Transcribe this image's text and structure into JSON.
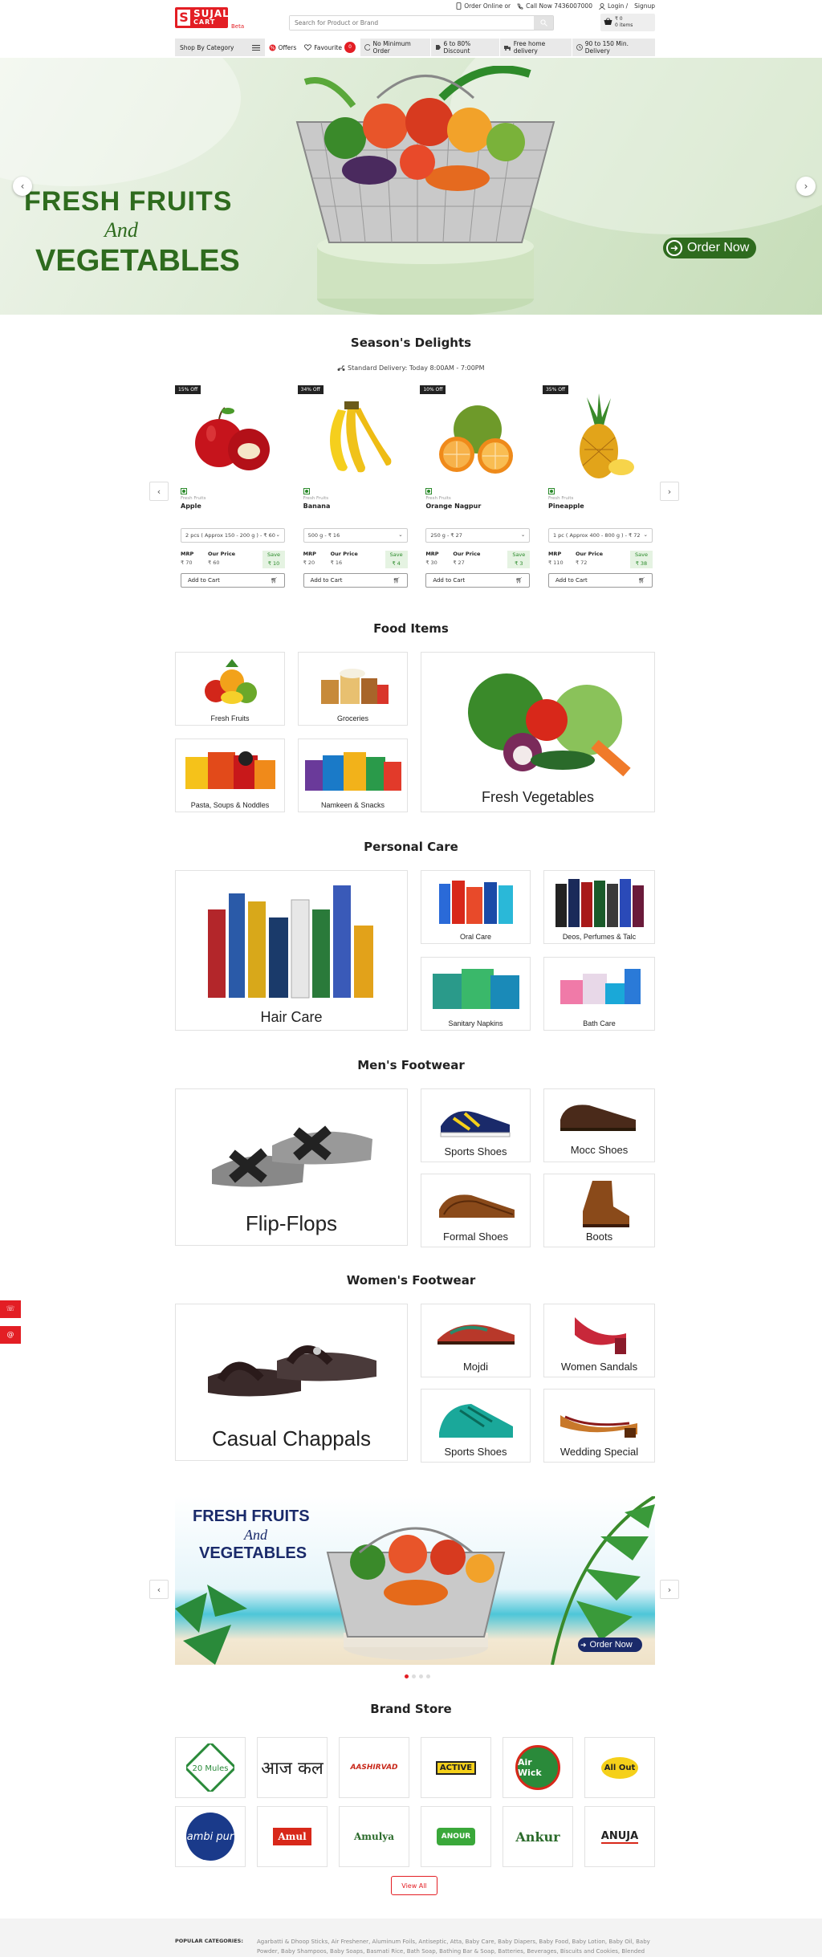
{
  "header": {
    "logo_main": "SUJAL",
    "logo_sub": "CART",
    "logo_letter": "S",
    "beta": "Beta",
    "order_online": "Order Online or",
    "call_now": "Call Now 7436007000",
    "login": "Login /",
    "signup": "Signup",
    "search_placeholder": "Search for Product or Brand",
    "cart_amount": "₹ 0",
    "cart_items": "0 items"
  },
  "nav": {
    "category": "Shop By Category",
    "offers": "Offers",
    "favourite": "Favourite",
    "favourite_count": "0",
    "features": [
      "No Minimum Order",
      "6 to 80% Discount",
      "Free home delivery",
      "90 to 150 Min. Delivery"
    ]
  },
  "hero": {
    "line1": "FRESH FRUITS",
    "and": "And",
    "line2": "VEGETABLES",
    "cta": "Order Now"
  },
  "season": {
    "title": "Season's Delights",
    "delivery": "Standard Delivery: Today 8:00AM - 7:00PM",
    "products": [
      {
        "off": "15% Off",
        "cat": "Fresh Fruits",
        "name": "Apple",
        "variant": "2 pcs ( Approx 150 - 200 g ) - ₹ 60",
        "mrp_label": "MRP",
        "mrp": "₹ 70",
        "our_label": "Our Price",
        "our": "₹ 60",
        "save_label": "Save",
        "save": "₹ 10",
        "add": "Add to Cart"
      },
      {
        "off": "34% Off",
        "cat": "Fresh Fruits",
        "name": "Banana",
        "variant": "500 g - ₹ 16",
        "mrp_label": "MRP",
        "mrp": "₹ 20",
        "our_label": "Our Price",
        "our": "₹ 16",
        "save_label": "Save",
        "save": "₹ 4",
        "add": "Add to Cart"
      },
      {
        "off": "10% Off",
        "cat": "Fresh Fruits",
        "name": "Orange Nagpur",
        "variant": "250 g - ₹ 27",
        "mrp_label": "MRP",
        "mrp": "₹ 30",
        "our_label": "Our Price",
        "our": "₹ 27",
        "save_label": "Save",
        "save": "₹ 3",
        "add": "Add to Cart"
      },
      {
        "off": "35% Off",
        "cat": "Fresh Fruits",
        "name": "Pineapple",
        "variant": "1 pc ( Approx 400 - 800 g ) - ₹ 72",
        "mrp_label": "MRP",
        "mrp": "₹ 110",
        "our_label": "Our Price",
        "our": "₹ 72",
        "save_label": "Save",
        "save": "₹ 38",
        "add": "Add to Cart"
      }
    ]
  },
  "food": {
    "title": "Food Items",
    "tiles": [
      "Fresh Fruits",
      "Groceries",
      "Pasta, Soups & Noddles",
      "Namkeen & Snacks",
      "Fresh Vegetables"
    ]
  },
  "personal": {
    "title": "Personal Care",
    "tiles": [
      "Hair Care",
      "Oral Care",
      "Deos, Perfumes & Talc",
      "Sanitary Napkins",
      "Bath Care"
    ]
  },
  "mens": {
    "title": "Men's Footwear",
    "tiles": [
      "Flip-Flops",
      "Sports Shoes",
      "Mocc Shoes",
      "Formal Shoes",
      "Boots"
    ]
  },
  "womens": {
    "title": "Women's Footwear",
    "tiles": [
      "Casual Chappals",
      "Mojdi",
      "Women Sandals",
      "Sports Shoes",
      "Wedding Special"
    ]
  },
  "banner2": {
    "line1": "FRESH FRUITS",
    "and": "And",
    "line2": "VEGETABLES",
    "cta": "Order Now"
  },
  "brands": {
    "title": "Brand Store",
    "items": [
      "20 Mules",
      "आज कल",
      "AASHIRVAD",
      "ACTIVE",
      "Air Wick",
      "All Out",
      "ambi pur",
      "Amul",
      "Amulya",
      "ANOUR",
      "Ankur",
      "ANUJA"
    ],
    "view_all": "View All"
  },
  "footer": {
    "label": "POPULAR CATEGORIES:",
    "text": "Agarbatti & Dhoop Sticks, Air Freshener, Aluminum Foils, Antiseptic, Atta, Baby Care, Baby Diapers, Baby Food, Baby Lotion, Baby Oil, Baby Powder, Baby Shampoos, Baby Soaps, Basmati Rice, Bath Soap, Bathing Bar & Soap, Batteries, Beverages, Biscuits and Cookies, Blended"
  },
  "colors": {
    "brand": "#e31e24",
    "green": "#2e6b1e"
  }
}
